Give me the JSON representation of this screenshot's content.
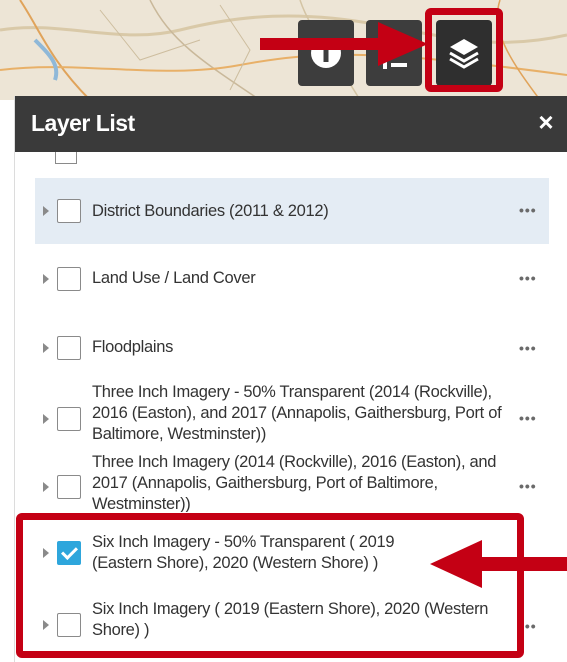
{
  "panel": {
    "title": "Layer List",
    "close_label": "×"
  },
  "layers": [
    {
      "label": "District Boundaries (2011 & 2012)",
      "checked": false
    },
    {
      "label": "Land Use / Land Cover",
      "checked": false
    },
    {
      "label": "Floodplains",
      "checked": false
    },
    {
      "label": "Three Inch Imagery - 50% Transparent (2014 (Rockville), 2016 (Easton), and 2017 (Annapolis, Gaithersburg, Port of Baltimore, Westminster))",
      "checked": false
    },
    {
      "label": "Three Inch Imagery (2014 (Rockville), 2016 (Easton), and 2017 (Annapolis, Gaithersburg, Port of Baltimore, Westminster))",
      "checked": false
    },
    {
      "label": "Six Inch Imagery - 50% Transparent ( 2019 (Eastern Shore), 2020 (Western Shore) )",
      "checked": true
    },
    {
      "label": "Six Inch Imagery ( 2019 (Eastern Shore), 2020 (Western Shore) )",
      "checked": false
    }
  ],
  "more_label": "•••",
  "icons": {
    "info": "info-icon",
    "legend": "legend-icon",
    "layers": "layers-icon"
  },
  "colors": {
    "highlight": "#c40014",
    "header": "#3a3a3a",
    "checked": "#2ea6dc",
    "selected_row": "#e4ecf4"
  }
}
